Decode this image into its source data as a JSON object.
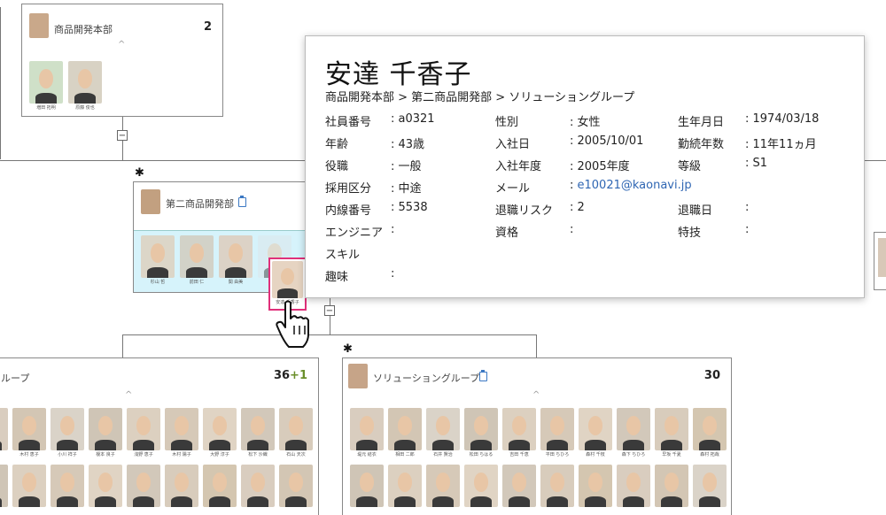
{
  "colors": {
    "accent": "#3b78c3",
    "highlight": "#e0307a",
    "selected_bg": "#d6f3fb",
    "link": "#2f66b3"
  },
  "top_card": {
    "title": "商品開発本部",
    "count": "2",
    "members": [
      {
        "name": "増田 拓明"
      },
      {
        "name": "原藤 俊也"
      }
    ]
  },
  "mid_card": {
    "title": "第二商品開発部",
    "members": [
      {
        "name": "杉山 哲"
      },
      {
        "name": "前田 仁"
      },
      {
        "name": "関 由美"
      }
    ],
    "selected_member": {
      "name": "安達 千香子"
    }
  },
  "left_card": {
    "title": "ループ",
    "count_main": "36",
    "count_plus": "+1",
    "members": [
      {
        "name": ""
      },
      {
        "name": "木村 恵子"
      },
      {
        "name": "小川 祥子"
      },
      {
        "name": "榎本 良子"
      },
      {
        "name": "浅野 恵子"
      },
      {
        "name": "木村 陽子"
      },
      {
        "name": "大野 淳子"
      },
      {
        "name": "松下 沙織"
      },
      {
        "name": "石山 天次"
      }
    ]
  },
  "right_card": {
    "title": "ソリューショングループ",
    "count": "30",
    "members": [
      {
        "name": "堤元 結衣"
      },
      {
        "name": "相田 二郎"
      },
      {
        "name": "石井 賢治"
      },
      {
        "name": "松田 ちはる"
      },
      {
        "name": "吉田 千恵"
      },
      {
        "name": "平田 ちひろ"
      },
      {
        "name": "森村 千枝"
      },
      {
        "name": "森下 ちひろ"
      },
      {
        "name": "早坂 千夏"
      },
      {
        "name": "森村 拓哉"
      }
    ]
  },
  "popup": {
    "name": "安達 千香子",
    "dept_path": "商品開発本部 > 第二商品開発部 > ソリューショングループ",
    "fields": [
      {
        "label": "社員番号",
        "value": ": a0321"
      },
      {
        "label": "性別",
        "value": ": 女性"
      },
      {
        "label": "生年月日",
        "value": ": 1974/03/18"
      },
      {
        "label": "年齢",
        "value": ": 43歳"
      },
      {
        "label": "入社日",
        "value": ": 2005/10/01"
      },
      {
        "label": "勤続年数",
        "value": ": 11年11ヵ月"
      },
      {
        "label": "役職",
        "value": ": 一般"
      },
      {
        "label": "入社年度",
        "value": ": 2005年度"
      },
      {
        "label": "等級",
        "value": ": S1"
      },
      {
        "label": "採用区分",
        "value": ": 中途"
      },
      {
        "label": "メール",
        "value": ": ",
        "link": "e10021@kaonavi.jp"
      },
      {
        "label": "",
        "value": ""
      },
      {
        "label": "内線番号",
        "value": ": 5538"
      },
      {
        "label": "退職リスク",
        "value": ": 2"
      },
      {
        "label": "退職日",
        "value": ":"
      },
      {
        "label": "エンジニア",
        "value": ":"
      },
      {
        "label": "資格",
        "value": ":"
      },
      {
        "label": "特技",
        "value": ":"
      },
      {
        "label": "スキル",
        "value": ""
      },
      {
        "label": "",
        "value": ""
      },
      {
        "label": "",
        "value": ""
      },
      {
        "label": "趣味",
        "value": ":"
      }
    ]
  },
  "icons": {
    "collapse": "⊟",
    "expand_up": "^",
    "star": "✱",
    "clipboard": "clipboard-icon",
    "cursor": "hand-pointer-icon"
  }
}
